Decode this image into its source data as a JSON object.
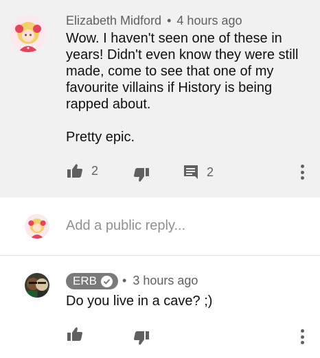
{
  "comment": {
    "author": "Elizabeth Midford",
    "separator": "•",
    "time": "4 hours ago",
    "body_lines": [
      "Wow. I haven't seen one of these in years! Didn't even know they were still made, come to see that one of my favourite villains if History is being rapped about.",
      "Pretty epic."
    ],
    "likes": "2",
    "replies": "2",
    "icons": {
      "like": "thumbs-up-icon",
      "dislike": "thumbs-down-icon",
      "reply": "comment-icon",
      "more": "more-vert-icon"
    }
  },
  "reply_box": {
    "placeholder": "Add a public reply..."
  },
  "reply": {
    "author_badge": "ERB",
    "separator": "•",
    "time": "3 hours ago",
    "body": "Do you live in a cave? ;)"
  },
  "colors": {
    "background_top": "#f1f1f1",
    "meta_text": "#606060",
    "badge": "#7a7a7a"
  }
}
